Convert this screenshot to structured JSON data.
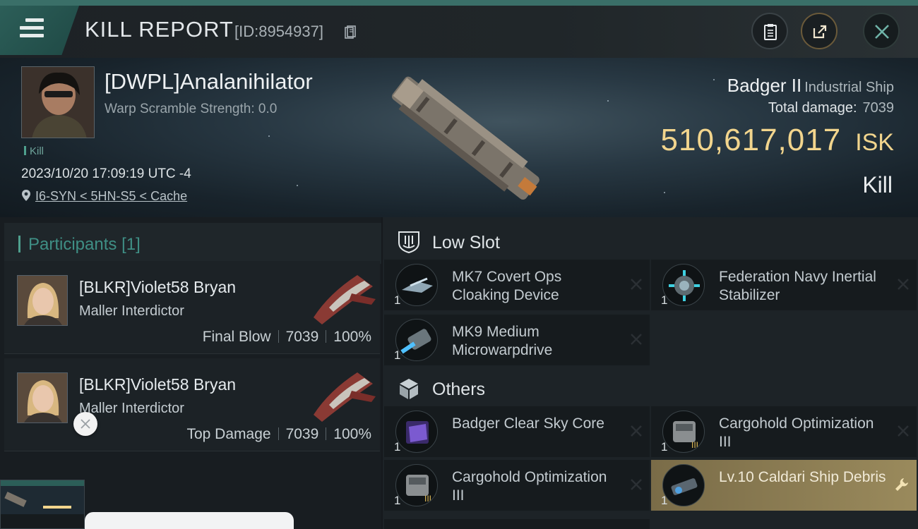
{
  "header": {
    "title": "KILL REPORT",
    "report_id": "[ID:8954937]"
  },
  "victim": {
    "name": "[DWPL]Analanihilator",
    "warp_scramble": "Warp Scramble Strength: 0.0",
    "kill_tag": "Kill",
    "datetime": "2023/10/20 17:09:19 UTC -4",
    "location": "I6-SYN < 5HN-S5 < Cache",
    "ship_name": "Badger II",
    "ship_class": "Industrial Ship",
    "total_damage_label": "Total damage:",
    "total_damage": "7039",
    "isk_value": "510,617,017",
    "isk_unit": "ISK",
    "result": "Kill"
  },
  "participants": {
    "label": "Participants",
    "count": "[1]",
    "rows": [
      {
        "name": "[BLKR]Violet58 Bryan",
        "ship": "Maller Interdictor",
        "role": "Final Blow",
        "damage": "7039",
        "percent": "100%"
      },
      {
        "name": "[BLKR]Violet58 Bryan",
        "ship": "Maller Interdictor",
        "role": "Top Damage",
        "damage": "7039",
        "percent": "100%"
      }
    ]
  },
  "low_slot": {
    "title": "Low Slot",
    "items": [
      {
        "qty": "1",
        "name": "MK7 Covert Ops Cloaking Device"
      },
      {
        "qty": "1",
        "name": "Federation Navy Inertial Stabilizer"
      },
      {
        "qty": "1",
        "name": "MK9 Medium Microwarpdrive"
      }
    ]
  },
  "others": {
    "title": "Others",
    "items": [
      {
        "qty": "1",
        "name": "Badger Clear Sky Core"
      },
      {
        "qty": "1",
        "name": "Cargohold Optimization III"
      },
      {
        "qty": "1",
        "name": "Cargohold Optimization III"
      },
      {
        "qty": "1",
        "name": "Lv.10 Caldari Ship Debris"
      }
    ]
  },
  "colors": {
    "accent_teal": "#3f8f85",
    "isk_gold": "#f2d58d",
    "highlight_gold": "#8f8056"
  }
}
